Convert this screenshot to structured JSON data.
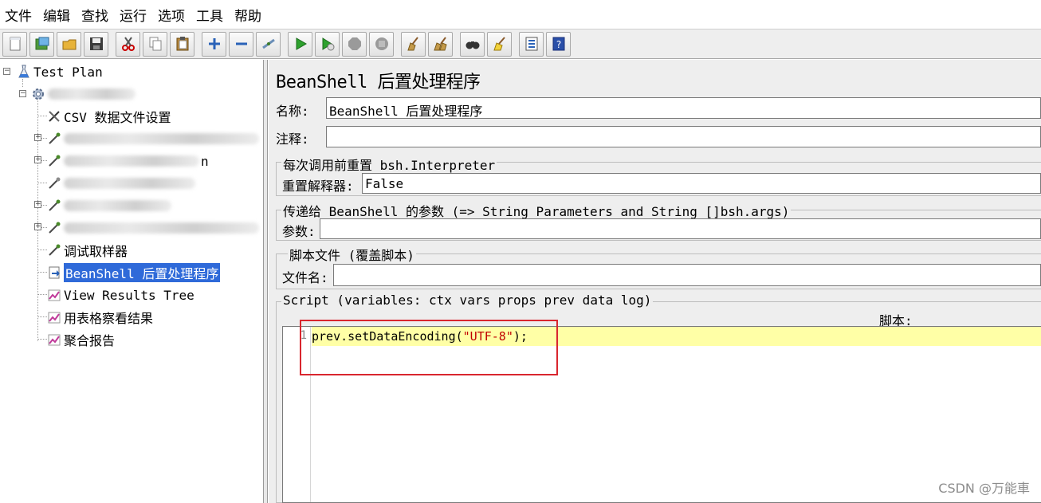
{
  "menu": [
    "文件",
    "编辑",
    "查找",
    "运行",
    "选项",
    "工具",
    "帮助"
  ],
  "toolbar_icons": [
    "new-icon",
    "templates-icon",
    "open-icon",
    "save-icon",
    "cut-icon",
    "copy-icon",
    "paste-icon",
    "expand-icon",
    "collapse-icon",
    "toggle-icon",
    "start-icon",
    "start-no-pause-icon",
    "stop-icon",
    "shutdown-icon",
    "clear-icon",
    "clear-all-icon",
    "search-icon",
    "reset-search-icon",
    "function-helper-icon",
    "help-icon"
  ],
  "tree": {
    "root": "Test Plan",
    "csv": "CSV 数据文件设置",
    "debug": "调试取样器",
    "beanshell": "BeanShell 后置处理程序",
    "results_tree": "View Results Tree",
    "table_results": "用表格察看结果",
    "aggregate": "聚合报告",
    "blurred_fragment": "n"
  },
  "panel": {
    "title": "BeanShell 后置处理程序",
    "name_label": "名称:",
    "name_value": "BeanShell 后置处理程序",
    "comment_label": "注释:",
    "comment_value": "",
    "reset_group_title": "每次调用前重置 bsh.Interpreter",
    "reset_label": "重置解释器:",
    "reset_value": "False",
    "params_group_title": "传递给 BeanShell 的参数 (=> String Parameters and String []bsh.args)",
    "params_label": "参数:",
    "params_value": "",
    "file_group_title": "脚本文件 (覆盖脚本)",
    "file_label": "文件名:",
    "file_value": "",
    "script_group_title": "Script (variables: ctx vars props prev data log)",
    "script_label": "脚本:",
    "line_number": "1",
    "code_prefix": "prev.setDataEncoding(",
    "code_string": "\"UTF-8\"",
    "code_suffix": ");"
  },
  "watermark": "CSDN @万能車"
}
